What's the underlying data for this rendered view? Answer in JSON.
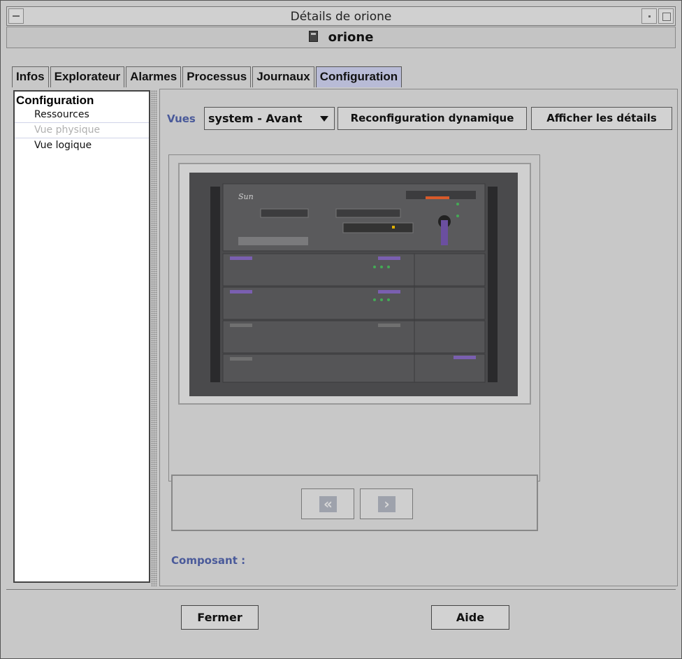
{
  "window": {
    "title": "Détails de orione",
    "host": "orione"
  },
  "tabs": [
    {
      "label": "Infos"
    },
    {
      "label": "Explorateur"
    },
    {
      "label": "Alarmes"
    },
    {
      "label": "Processus"
    },
    {
      "label": "Journaux"
    },
    {
      "label": "Configuration",
      "active": true
    }
  ],
  "tree": {
    "root": "Configuration",
    "items": [
      {
        "label": "Ressources",
        "enabled": true
      },
      {
        "label": "Vue physique",
        "enabled": false
      },
      {
        "label": "Vue logique",
        "enabled": true
      }
    ]
  },
  "toolbar": {
    "views_label": "Vues",
    "views_selected": "system - Avant",
    "reconfig_label": "Reconfiguration dynamique",
    "details_label": "Afficher les détails"
  },
  "viewer": {
    "image_desc": "Sun Enterprise server front view"
  },
  "component_label": "Composant :",
  "buttons": {
    "close": "Fermer",
    "help": "Aide"
  },
  "colors": {
    "active_tab": "#b8bbd6",
    "label_blue": "#4a5a9a",
    "rack": "#4a4a4c"
  }
}
